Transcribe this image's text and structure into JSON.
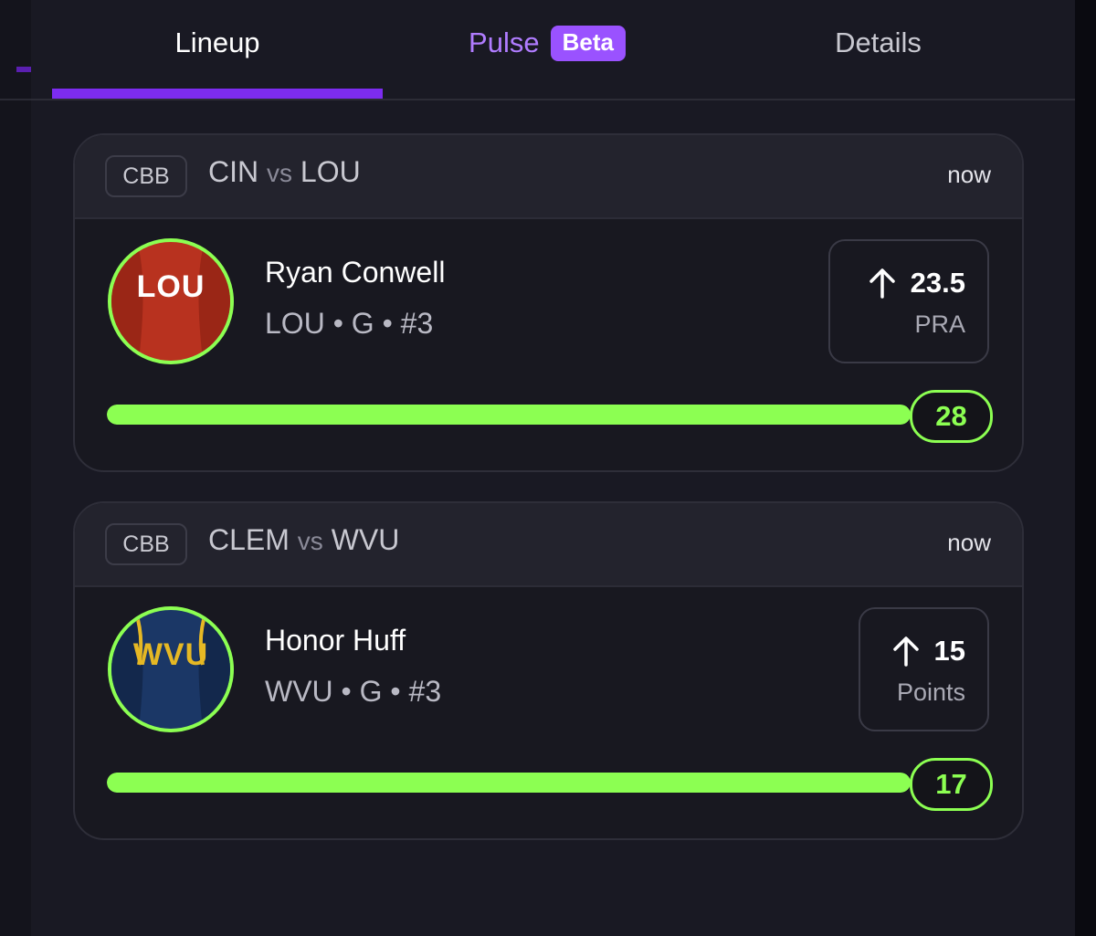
{
  "tabs": {
    "lineup": "Lineup",
    "pulse": "Pulse",
    "pulse_badge": "Beta",
    "details": "Details",
    "active": "lineup"
  },
  "colors": {
    "accent_purple": "#7d2cf0",
    "beta_badge": "#9a52ff",
    "progress_green": "#8cff52",
    "background": "#191923"
  },
  "cards": [
    {
      "league": "CBB",
      "home": "CIN",
      "vs": "vs",
      "away": "LOU",
      "time": "now",
      "player": {
        "name": "Ryan Conwell",
        "meta": "LOU • G • #3",
        "jersey_text": "LOU",
        "jersey_color": "#b8321f",
        "jersey_text_color": "#ffffff"
      },
      "line": {
        "direction_icon": "arrow-up-icon",
        "value": "23.5",
        "stat": "PRA"
      },
      "progress": {
        "value": "28",
        "fill_fraction": 1.0
      }
    },
    {
      "league": "CBB",
      "home": "CLEM",
      "vs": "vs",
      "away": "WVU",
      "time": "now",
      "player": {
        "name": "Honor Huff",
        "meta": "WVU • G • #3",
        "jersey_text": "WVU",
        "jersey_color": "#1b3766",
        "jersey_text_color": "#e6b824"
      },
      "line": {
        "direction_icon": "arrow-up-icon",
        "value": "15",
        "stat": "Points"
      },
      "progress": {
        "value": "17",
        "fill_fraction": 1.0
      }
    }
  ]
}
